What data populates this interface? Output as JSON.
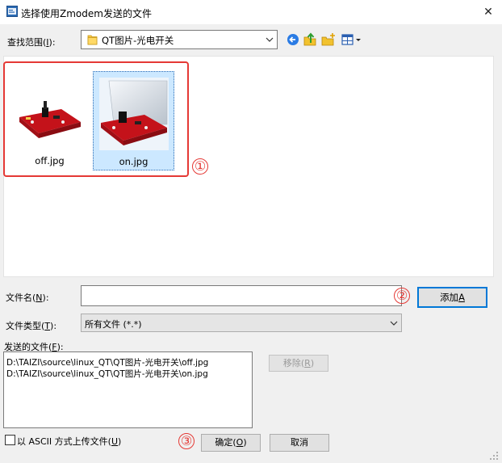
{
  "window": {
    "title": "选择使用Zmodem发送的文件",
    "close_glyph": "✕"
  },
  "lookin": {
    "label_text": "查找范围(",
    "label_key": "I",
    "label_end": "):",
    "value": "QT图片-光电开关"
  },
  "toolbar": {
    "icons": [
      "back-icon",
      "up-folder-icon",
      "new-folder-icon",
      "view-menu-icon"
    ]
  },
  "files": [
    {
      "name": "off.jpg",
      "selected": false
    },
    {
      "name": "on.jpg",
      "selected": true
    }
  ],
  "annotations": {
    "one": "①",
    "two": "②",
    "three": "③"
  },
  "filename": {
    "label_text": "文件名(",
    "label_key": "N",
    "label_end": "):",
    "value": ""
  },
  "add_button": {
    "text": "添加",
    "key": "A"
  },
  "filetype": {
    "label_text": "文件类型(",
    "label_key": "T",
    "label_end": "):",
    "value": "所有文件 (*.*)"
  },
  "sent": {
    "label_text": "发送的文件(",
    "label_key": "F",
    "label_end": "):",
    "items": [
      "D:\\TAIZI\\source\\linux_QT\\QT图片-光电开关\\off.jpg",
      "D:\\TAIZI\\source\\linux_QT\\QT图片-光电开关\\on.jpg"
    ]
  },
  "remove_button": {
    "text": "移除(",
    "key": "R",
    "end": ")"
  },
  "ascii": {
    "text": "以 ASCII 方式上传文件(",
    "key": "U",
    "end": ")",
    "checked": false
  },
  "ok_button": {
    "text": "确定(",
    "key": "O",
    "end": ")"
  },
  "cancel_button": {
    "text": "取消"
  },
  "colors": {
    "accent": "#0078d7",
    "annotation": "#e53935",
    "selection": "#cce8ff",
    "pcb_red": "#d0161e"
  }
}
